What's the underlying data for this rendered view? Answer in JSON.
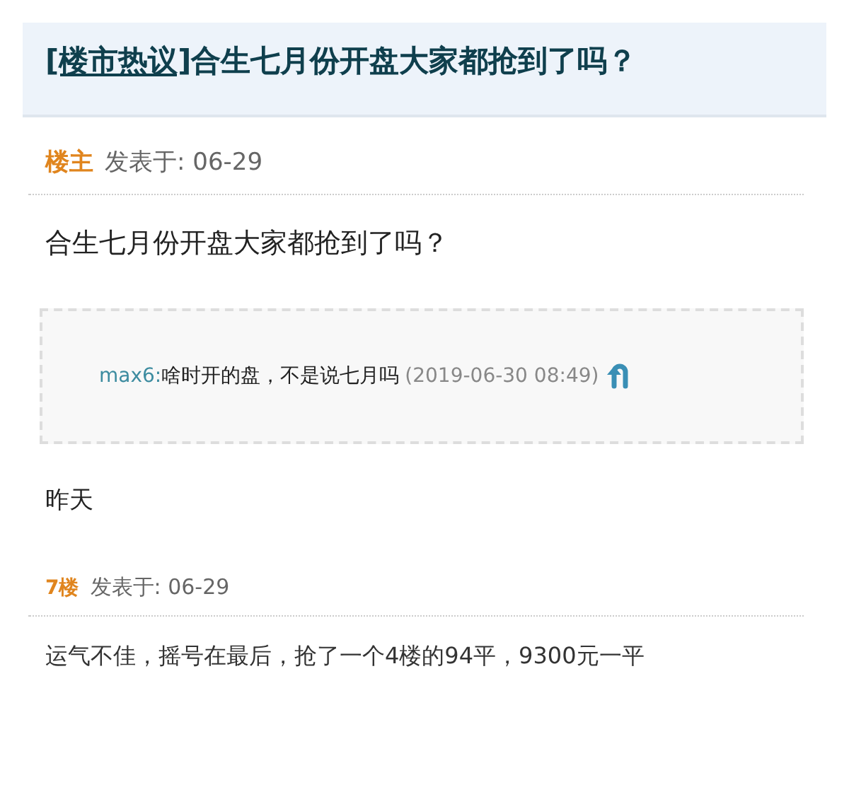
{
  "thread": {
    "category": "[楼市热议]",
    "title": "合生七月份开盘大家都抢到了吗？"
  },
  "posts": [
    {
      "kind": "original",
      "floor": "楼主",
      "posted": "发表于: 06-29",
      "body": "合生七月份开盘大家都抢到了吗？",
      "comments": [
        {
          "user": "max6:",
          "text": "啥时开的盘，不是说七月吗",
          "time": "(2019-06-30 08:49)"
        }
      ],
      "follow_up": "昨天"
    },
    {
      "kind": "reply",
      "floor": "7楼",
      "posted": "发表于: 06-29",
      "body": "运气不佳，摇号在最后，抢了一个4楼的94平，9300元一平"
    }
  ]
}
